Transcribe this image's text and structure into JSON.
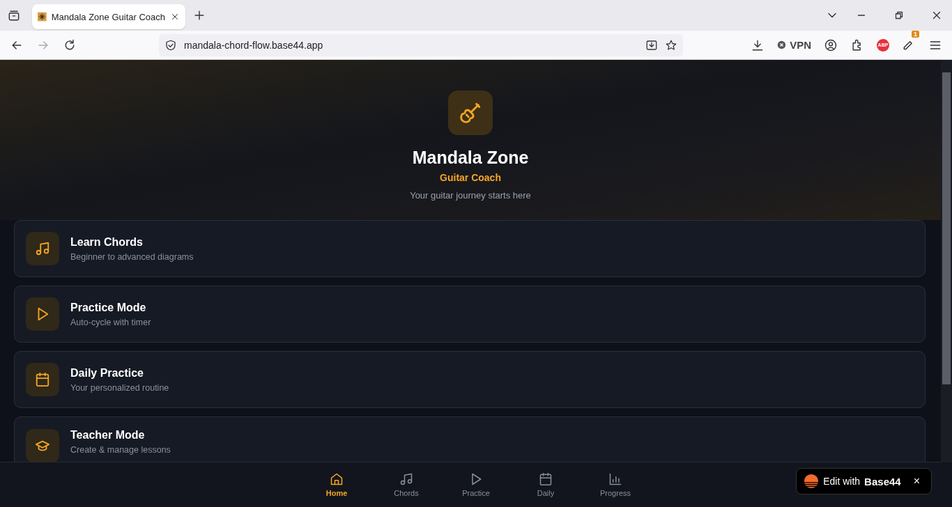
{
  "browser": {
    "tab_title": "Mandala Zone Guitar Coach",
    "url": "mandala-chord-flow.base44.app",
    "vpn_label": "VPN",
    "adblock_label": "ABP",
    "extension_badge": "1"
  },
  "header": {
    "title": "Mandala Zone",
    "subtitle": "Guitar Coach",
    "tagline": "Your guitar journey starts here"
  },
  "cards": [
    {
      "kind": "music",
      "title": "Learn Chords",
      "description": "Beginner to advanced diagrams"
    },
    {
      "kind": "play",
      "title": "Practice Mode",
      "description": "Auto-cycle with timer"
    },
    {
      "kind": "calendar",
      "title": "Daily Practice",
      "description": "Your personalized routine"
    },
    {
      "kind": "cap",
      "title": "Teacher Mode",
      "description": "Create & manage lessons"
    }
  ],
  "nav": [
    {
      "kind": "home",
      "label": "Home",
      "selected": true
    },
    {
      "kind": "music",
      "label": "Chords",
      "selected": false
    },
    {
      "kind": "play",
      "label": "Practice",
      "selected": false
    },
    {
      "kind": "calendar",
      "label": "Daily",
      "selected": false
    },
    {
      "kind": "chart",
      "label": "Progress",
      "selected": false
    }
  ],
  "edit_badge": {
    "prefix": "Edit with",
    "brand": "Base44",
    "close": "×"
  }
}
